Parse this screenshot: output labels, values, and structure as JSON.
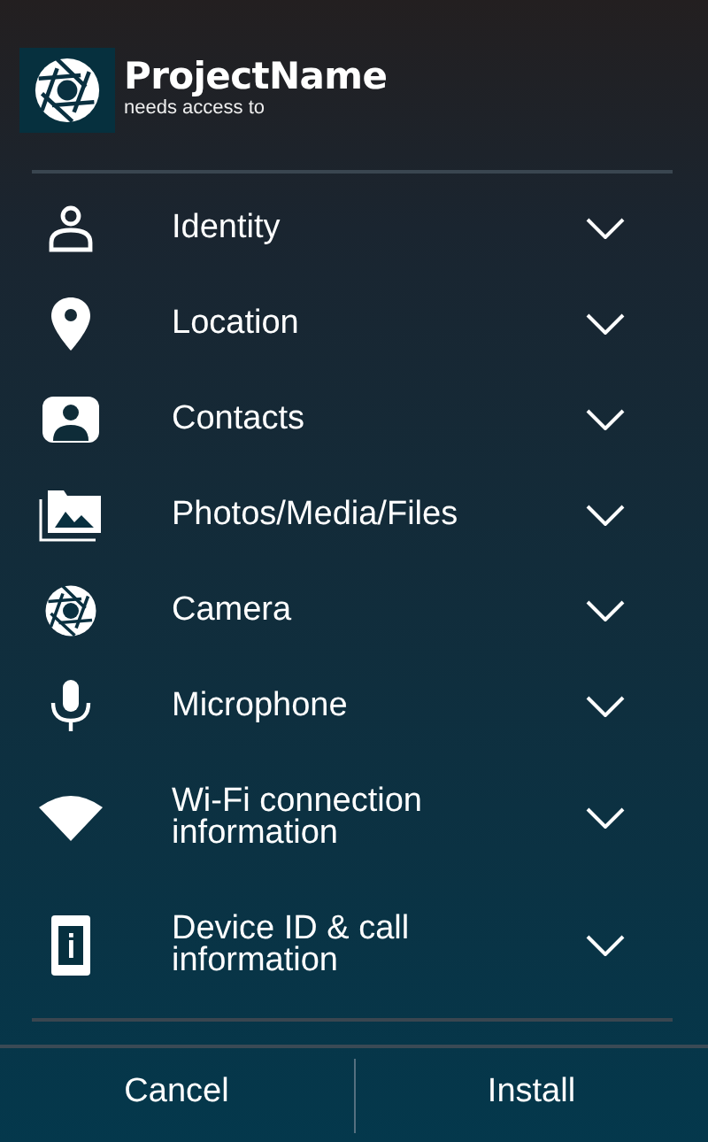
{
  "app": {
    "name": "ProjectName",
    "subtitle": "needs access to"
  },
  "permissions": [
    {
      "label": "Identity",
      "expanded": false
    },
    {
      "label": "Location",
      "expanded": false
    },
    {
      "label": "Contacts",
      "expanded": false
    },
    {
      "label": "Photos/Media/Files",
      "expanded": false
    },
    {
      "label": "Camera",
      "expanded": false
    },
    {
      "label": "Microphone",
      "expanded": false
    },
    {
      "label": "Wi-Fi connection information",
      "expanded": false
    },
    {
      "label": "Device ID & call information",
      "expanded": false
    }
  ],
  "buttons": [
    "Cancel",
    "Install"
  ]
}
